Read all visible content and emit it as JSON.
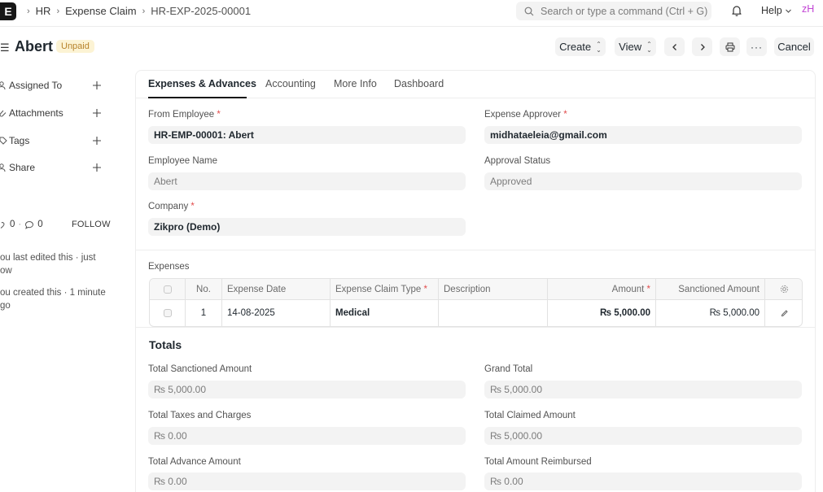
{
  "navbar": {
    "logo_letter": "E",
    "breadcrumbs": [
      "HR",
      "Expense Claim",
      "HR-EXP-2025-00001"
    ],
    "search_placeholder": "Search or type a command (Ctrl + G)",
    "help_label": "Help",
    "avatar_initials": "zH"
  },
  "header": {
    "title": "Abert",
    "status_badge": "Unpaid",
    "buttons": {
      "create": "Create",
      "view": "View",
      "cancel": "Cancel"
    }
  },
  "sidebar": {
    "items": [
      {
        "label": "Assigned To"
      },
      {
        "label": "Attachments"
      },
      {
        "label": "Tags"
      },
      {
        "label": "Share"
      }
    ],
    "likes": "0",
    "comments": "0",
    "follow_label": "FOLLOW",
    "activity": [
      "ou last edited this · just ow",
      "ou created this · 1 minute go"
    ]
  },
  "tabs": [
    "Expenses & Advances",
    "Accounting",
    "More Info",
    "Dashboard"
  ],
  "form": {
    "from_employee": {
      "label": "From Employee",
      "value": "HR-EMP-00001: Abert"
    },
    "expense_approver": {
      "label": "Expense Approver",
      "value": "midhataeleia@gmail.com"
    },
    "employee_name": {
      "label": "Employee Name",
      "value": "Abert"
    },
    "approval_status": {
      "label": "Approval Status",
      "value": "Approved"
    },
    "company": {
      "label": "Company",
      "value": "Zikpro (Demo)"
    }
  },
  "expenses": {
    "section_label": "Expenses",
    "columns": {
      "no": "No.",
      "expense_date": "Expense Date",
      "claim_type": "Expense Claim Type",
      "description": "Description",
      "amount": "Amount",
      "sanctioned": "Sanctioned Amount"
    },
    "rows": [
      {
        "no": "1",
        "expense_date": "14-08-2025",
        "claim_type": "Medical",
        "description": "",
        "amount": "₨ 5,000.00",
        "sanctioned": "₨ 5,000.00"
      }
    ]
  },
  "totals": {
    "heading": "Totals",
    "total_sanctioned": {
      "label": "Total Sanctioned Amount",
      "value": "₨ 5,000.00"
    },
    "grand_total": {
      "label": "Grand Total",
      "value": "₨ 5,000.00"
    },
    "total_taxes": {
      "label": "Total Taxes and Charges",
      "value": "₨ 0.00"
    },
    "total_claimed": {
      "label": "Total Claimed Amount",
      "value": "₨ 5,000.00"
    },
    "total_advance": {
      "label": "Total Advance Amount",
      "value": "₨ 0.00"
    },
    "total_reimbursed": {
      "label": "Total Amount Reimbursed",
      "value": "₨ 0.00"
    }
  }
}
